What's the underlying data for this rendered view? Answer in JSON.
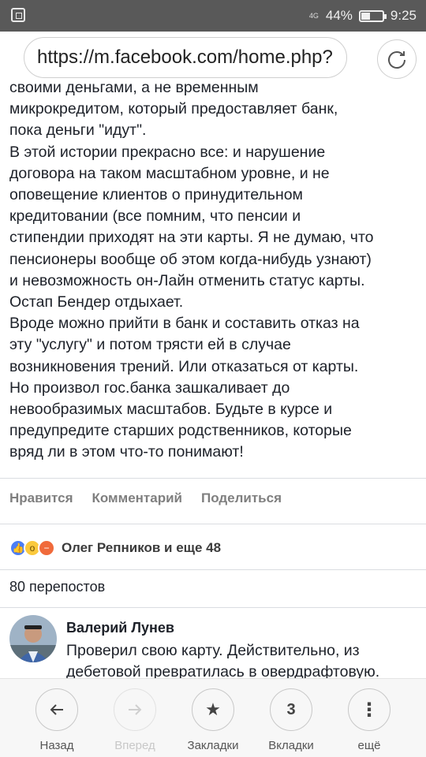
{
  "status_bar": {
    "network": "4G",
    "battery": "44%",
    "time": "9:25"
  },
  "address_bar": {
    "url": "https://m.facebook.com/home.php?"
  },
  "post": {
    "lines": [
      "своими деньгами, а не временным",
      "микрокредитом, который предоставляет банк,",
      "пока деньги \"идут\".",
      "В этой истории прекрасно все: и нарушение",
      "договора на таком масштабном уровне, и не",
      "оповещение клиентов о принудительном",
      "кредитовании (все помним, что пенсии и",
      "стипендии приходят на эти карты. Я не думаю, что",
      "пенсионеры вообще об этом когда-нибудь узнают)",
      "и невозможность он-Лайн отменить статус карты.",
      "Остап Бендер отдыхает.",
      "Вроде можно прийти в банк и составить отказ на",
      "эту \"услугу\" и потом трясти ей в случае",
      "возникновения трений. Или отказаться от карты.",
      "Но произвол гос.банка зашкаливает до",
      "невообразимых масштабов. Будьте в курсе и",
      "предупредите старших родственников, которые",
      "вряд ли в этом что-то понимают!"
    ]
  },
  "actions": {
    "like": "Нравится",
    "comment": "Комментарий",
    "share": "Поделиться"
  },
  "reactions": {
    "text": "Олег Репников и еще 48",
    "icons": [
      "like-icon",
      "wow-icon",
      "angry-icon"
    ]
  },
  "shares": "80 перепостов",
  "comment": {
    "author": "Валерий Лунев",
    "lines": [
      "Проверил свою карту. Действительно, из",
      "дебетовой превратилась в овердрафтовую."
    ]
  },
  "bottom_nav": {
    "back": "Назад",
    "forward": "Вперед",
    "bookmarks": "Закладки",
    "tabs": "Вкладки",
    "tabs_count": "3",
    "more": "ещё"
  },
  "colors": {
    "status_bar": "#595959",
    "link_gray": "#7f7f7f",
    "like_blue": "#4b7ef6"
  }
}
